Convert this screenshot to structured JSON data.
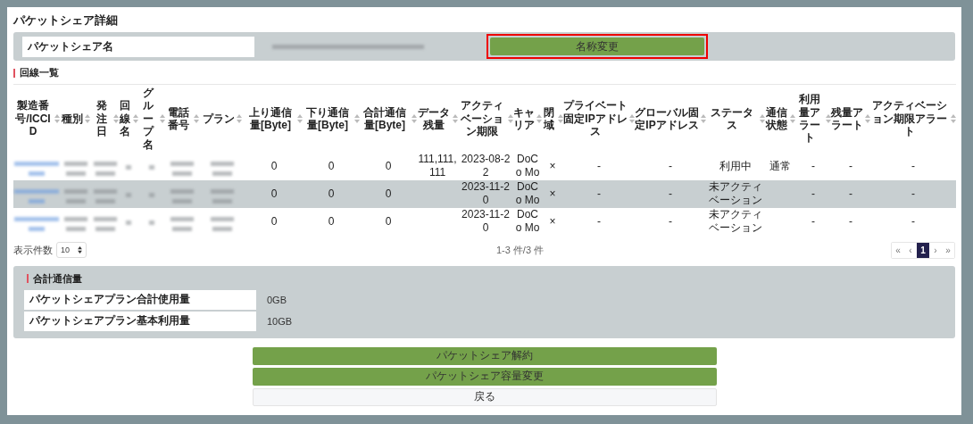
{
  "title": "パケットシェア詳細",
  "share_name": {
    "label": "パケットシェア名",
    "value": {
      "kind": "blurred"
    },
    "rename_button": {
      "label": "名称変更",
      "highlighted": true
    }
  },
  "lines": {
    "heading": "回線一覧",
    "columns": [
      "製造番号/ICCID",
      "種別",
      "発注日",
      "回線名",
      "グループ名",
      "電話番号",
      "プラン",
      "上り通信量[Byte]",
      "下り通信量[Byte]",
      "合計通信量[Byte]",
      "データ残量",
      "アクティベーション期限",
      "キャリア",
      "閉域",
      "プライベート固定IPアドレス",
      "グローバル固定IPアドレス",
      "ステータス",
      "通信状態",
      "利用量アラート",
      "残量アラート",
      "アクティベーション期限アラート"
    ],
    "rows": [
      [
        {
          "kind": "blurred_link"
        },
        {
          "kind": "blurred"
        },
        {
          "kind": "blurred"
        },
        {
          "kind": "blurred_short"
        },
        {
          "kind": "blurred_short"
        },
        {
          "kind": "blurred"
        },
        {
          "kind": "blurred"
        },
        {
          "kind": "text",
          "text": "0"
        },
        {
          "kind": "text",
          "text": "0"
        },
        {
          "kind": "text",
          "text": "0"
        },
        {
          "kind": "text",
          "text": "111,111,111"
        },
        {
          "kind": "text",
          "text": "2023-08-22"
        },
        {
          "kind": "text",
          "text": "DoCo Mo"
        },
        {
          "kind": "text",
          "text": "×"
        },
        {
          "kind": "text",
          "text": "-"
        },
        {
          "kind": "text",
          "text": "-"
        },
        {
          "kind": "text",
          "text": "利用中"
        },
        {
          "kind": "text",
          "text": "通常"
        },
        {
          "kind": "text",
          "text": "-"
        },
        {
          "kind": "text",
          "text": "-"
        },
        {
          "kind": "text",
          "text": "-"
        }
      ],
      [
        {
          "kind": "blurred_link"
        },
        {
          "kind": "blurred"
        },
        {
          "kind": "blurred"
        },
        {
          "kind": "blurred_short"
        },
        {
          "kind": "blurred_short"
        },
        {
          "kind": "blurred"
        },
        {
          "kind": "blurred"
        },
        {
          "kind": "text",
          "text": "0"
        },
        {
          "kind": "text",
          "text": "0"
        },
        {
          "kind": "text",
          "text": "0"
        },
        {
          "kind": "empty"
        },
        {
          "kind": "text",
          "text": "2023-11-20"
        },
        {
          "kind": "text",
          "text": "DoCo Mo"
        },
        {
          "kind": "text",
          "text": "×"
        },
        {
          "kind": "text",
          "text": "-"
        },
        {
          "kind": "text",
          "text": "-"
        },
        {
          "kind": "text",
          "text": "未アクティベーション"
        },
        {
          "kind": "empty"
        },
        {
          "kind": "text",
          "text": "-"
        },
        {
          "kind": "text",
          "text": "-"
        },
        {
          "kind": "text",
          "text": "-"
        }
      ],
      [
        {
          "kind": "blurred_link"
        },
        {
          "kind": "blurred"
        },
        {
          "kind": "blurred"
        },
        {
          "kind": "blurred_short"
        },
        {
          "kind": "blurred_short"
        },
        {
          "kind": "blurred"
        },
        {
          "kind": "blurred"
        },
        {
          "kind": "text",
          "text": "0"
        },
        {
          "kind": "text",
          "text": "0"
        },
        {
          "kind": "text",
          "text": "0"
        },
        {
          "kind": "empty"
        },
        {
          "kind": "text",
          "text": "2023-11-20"
        },
        {
          "kind": "text",
          "text": "DoCo Mo"
        },
        {
          "kind": "text",
          "text": "×"
        },
        {
          "kind": "text",
          "text": "-"
        },
        {
          "kind": "text",
          "text": "-"
        },
        {
          "kind": "text",
          "text": "未アクティベーション"
        },
        {
          "kind": "empty"
        },
        {
          "kind": "text",
          "text": "-"
        },
        {
          "kind": "text",
          "text": "-"
        },
        {
          "kind": "text",
          "text": "-"
        }
      ]
    ],
    "page_size": {
      "label": "表示件数",
      "value": "10"
    },
    "count": "1-3 件/3 件",
    "pagination": [
      {
        "label": "«",
        "selected": false
      },
      {
        "label": "‹",
        "selected": false
      },
      {
        "label": "1",
        "selected": true
      },
      {
        "label": "›",
        "selected": false
      },
      {
        "label": "»",
        "selected": false
      }
    ]
  },
  "traffic": {
    "heading": "合計通信量",
    "items": [
      {
        "label": "パケットシェアプラン合計使用量",
        "value": "0GB"
      },
      {
        "label": "パケットシェアプラン基本利用量",
        "value": "10GB"
      }
    ]
  },
  "actions": [
    {
      "label": "パケットシェア解約",
      "kind": "primary"
    },
    {
      "label": "パケットシェア容量変更",
      "kind": "primary"
    },
    {
      "label": "戻る",
      "kind": "secondary"
    }
  ]
}
